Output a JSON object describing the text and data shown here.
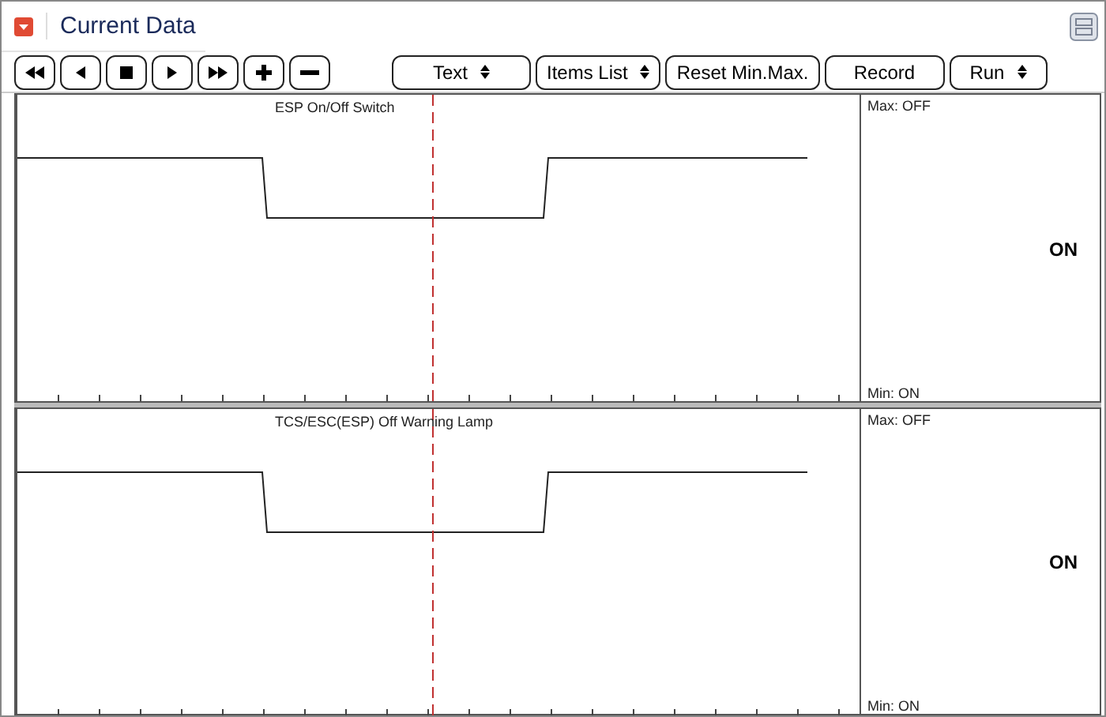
{
  "header": {
    "title": "Current Data"
  },
  "toolbar": {
    "media_buttons": [
      {
        "kind": "rewind"
      },
      {
        "kind": "back"
      },
      {
        "kind": "stop"
      },
      {
        "kind": "play"
      },
      {
        "kind": "forward"
      },
      {
        "kind": "plus"
      },
      {
        "kind": "minus"
      }
    ],
    "controls": [
      {
        "label": "Text",
        "kind": "select"
      },
      {
        "label": "Items List",
        "kind": "select"
      },
      {
        "label": "Reset Min.Max.",
        "kind": "button"
      },
      {
        "label": "Record",
        "kind": "button"
      },
      {
        "label": "Run",
        "kind": "select"
      }
    ]
  },
  "panels": [
    {
      "title": "ESP On/Off Switch",
      "max": "Max: OFF",
      "min": "Min: ON",
      "value": "ON"
    },
    {
      "title": "TCS/ESC(ESP) Off Warning Lamp",
      "max": "Max: OFF",
      "min": "Min: ON",
      "value": "ON"
    }
  ]
}
